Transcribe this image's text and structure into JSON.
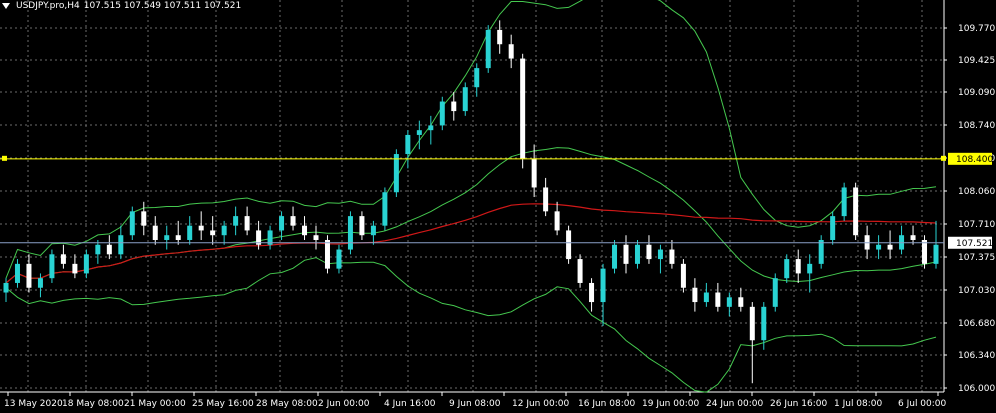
{
  "header": {
    "symbol": "USDJPY.pro,H4",
    "ohlc": "107.515 107.549 107.511 107.521"
  },
  "colors": {
    "background": "#000000",
    "grid": "#6b6b6b",
    "bull_candle": "#29d3d3",
    "bear_candle": "#ffffff",
    "bollinger": "#45c84f",
    "moving_average": "#d01818",
    "horizontal_line": "#ffff00",
    "bid_line": "#8aa0c8"
  },
  "chart_data": {
    "type": "candlestick",
    "price_axis": {
      "ticks": [
        "109.770",
        "109.425",
        "109.090",
        "108.740",
        "108.400",
        "108.060",
        "107.710",
        "107.375",
        "107.030",
        "106.680",
        "106.340",
        "106.000"
      ],
      "range": [
        105.97,
        110.0
      ]
    },
    "time_axis": {
      "labels": [
        "13 May 2020",
        "18 May 08:00",
        "21 May 00:00",
        "25 May 16:00",
        "28 May 08:00",
        "2 Jun 00:00",
        "4 Jun 16:00",
        "9 Jun 08:00",
        "12 Jun 00:00",
        "16 Jun 08:00",
        "19 Jun 00:00",
        "24 Jun 00:00",
        "26 Jun 16:00",
        "1 Jul 08:00",
        "6 Jul 00:00"
      ]
    },
    "horizontal_line": {
      "price": 108.4,
      "label": "108.400"
    },
    "current_price": {
      "price": 107.521,
      "label": "107.521"
    },
    "candles": [
      [
        107.0,
        107.15,
        106.9,
        107.1
      ],
      [
        107.1,
        107.35,
        107.05,
        107.3
      ],
      [
        107.3,
        107.4,
        107.0,
        107.05
      ],
      [
        107.05,
        107.2,
        106.95,
        107.15
      ],
      [
        107.15,
        107.45,
        107.1,
        107.4
      ],
      [
        107.4,
        107.5,
        107.25,
        107.3
      ],
      [
        107.3,
        107.4,
        107.15,
        107.2
      ],
      [
        107.2,
        107.45,
        107.15,
        107.4
      ],
      [
        107.4,
        107.55,
        107.3,
        107.5
      ],
      [
        107.5,
        107.6,
        107.35,
        107.4
      ],
      [
        107.4,
        107.7,
        107.35,
        107.6
      ],
      [
        107.6,
        107.9,
        107.55,
        107.85
      ],
      [
        107.85,
        107.95,
        107.6,
        107.7
      ],
      [
        107.7,
        107.8,
        107.5,
        107.55
      ],
      [
        107.55,
        107.7,
        107.45,
        107.6
      ],
      [
        107.6,
        107.75,
        107.5,
        107.55
      ],
      [
        107.55,
        107.8,
        107.5,
        107.7
      ],
      [
        107.7,
        107.85,
        107.55,
        107.65
      ],
      [
        107.65,
        107.8,
        107.5,
        107.6
      ],
      [
        107.6,
        107.75,
        107.5,
        107.7
      ],
      [
        107.7,
        107.9,
        107.6,
        107.8
      ],
      [
        107.8,
        107.9,
        107.6,
        107.65
      ],
      [
        107.65,
        107.75,
        107.45,
        107.5
      ],
      [
        107.5,
        107.7,
        107.45,
        107.65
      ],
      [
        107.65,
        107.85,
        107.55,
        107.8
      ],
      [
        107.8,
        107.9,
        107.65,
        107.7
      ],
      [
        107.7,
        107.8,
        107.55,
        107.6
      ],
      [
        107.6,
        107.7,
        107.45,
        107.55
      ],
      [
        107.55,
        107.6,
        107.2,
        107.25
      ],
      [
        107.25,
        107.5,
        107.2,
        107.45
      ],
      [
        107.45,
        107.85,
        107.4,
        107.8
      ],
      [
        107.8,
        107.85,
        107.55,
        107.6
      ],
      [
        107.6,
        107.75,
        107.5,
        107.7
      ],
      [
        107.7,
        108.1,
        107.65,
        108.05
      ],
      [
        108.05,
        108.5,
        108.0,
        108.45
      ],
      [
        108.45,
        108.7,
        108.3,
        108.65
      ],
      [
        108.65,
        108.8,
        108.5,
        108.7
      ],
      [
        108.7,
        108.85,
        108.55,
        108.75
      ],
      [
        108.75,
        109.05,
        108.7,
        109.0
      ],
      [
        109.0,
        109.1,
        108.8,
        108.9
      ],
      [
        108.9,
        109.2,
        108.85,
        109.15
      ],
      [
        109.15,
        109.4,
        109.05,
        109.35
      ],
      [
        109.35,
        109.8,
        109.3,
        109.75
      ],
      [
        109.75,
        109.85,
        109.5,
        109.6
      ],
      [
        109.6,
        109.7,
        109.35,
        109.45
      ],
      [
        109.45,
        109.5,
        108.3,
        108.4
      ],
      [
        108.4,
        108.55,
        108.0,
        108.1
      ],
      [
        108.1,
        108.2,
        107.8,
        107.85
      ],
      [
        107.85,
        107.95,
        107.6,
        107.65
      ],
      [
        107.65,
        107.7,
        107.3,
        107.35
      ],
      [
        107.35,
        107.4,
        107.05,
        107.1
      ],
      [
        107.1,
        107.15,
        106.8,
        106.9
      ],
      [
        106.9,
        107.3,
        106.65,
        107.25
      ],
      [
        107.25,
        107.55,
        107.2,
        107.5
      ],
      [
        107.5,
        107.6,
        107.2,
        107.3
      ],
      [
        107.3,
        107.55,
        107.25,
        107.5
      ],
      [
        107.5,
        107.6,
        107.3,
        107.35
      ],
      [
        107.35,
        107.5,
        107.2,
        107.45
      ],
      [
        107.45,
        107.55,
        107.25,
        107.3
      ],
      [
        107.3,
        107.35,
        107.0,
        107.05
      ],
      [
        107.05,
        107.15,
        106.8,
        106.9
      ],
      [
        106.9,
        107.1,
        106.85,
        107.0
      ],
      [
        107.0,
        107.1,
        106.8,
        106.85
      ],
      [
        106.85,
        107.0,
        106.75,
        106.95
      ],
      [
        106.95,
        107.05,
        106.8,
        106.85
      ],
      [
        106.85,
        106.9,
        106.05,
        106.5
      ],
      [
        106.5,
        106.9,
        106.4,
        106.85
      ],
      [
        106.85,
        107.2,
        106.8,
        107.15
      ],
      [
        107.15,
        107.4,
        107.1,
        107.35
      ],
      [
        107.35,
        107.45,
        107.1,
        107.2
      ],
      [
        107.2,
        107.4,
        107.0,
        107.3
      ],
      [
        107.3,
        107.6,
        107.25,
        107.55
      ],
      [
        107.55,
        107.85,
        107.5,
        107.8
      ],
      [
        107.8,
        108.15,
        107.75,
        108.1
      ],
      [
        108.1,
        108.15,
        107.55,
        107.6
      ],
      [
        107.6,
        107.7,
        107.35,
        107.45
      ],
      [
        107.45,
        107.6,
        107.35,
        107.5
      ],
      [
        107.5,
        107.65,
        107.35,
        107.45
      ],
      [
        107.45,
        107.7,
        107.4,
        107.6
      ],
      [
        107.6,
        107.7,
        107.5,
        107.55
      ],
      [
        107.55,
        107.6,
        107.25,
        107.3
      ],
      [
        107.3,
        107.75,
        107.25,
        107.5
      ]
    ]
  }
}
